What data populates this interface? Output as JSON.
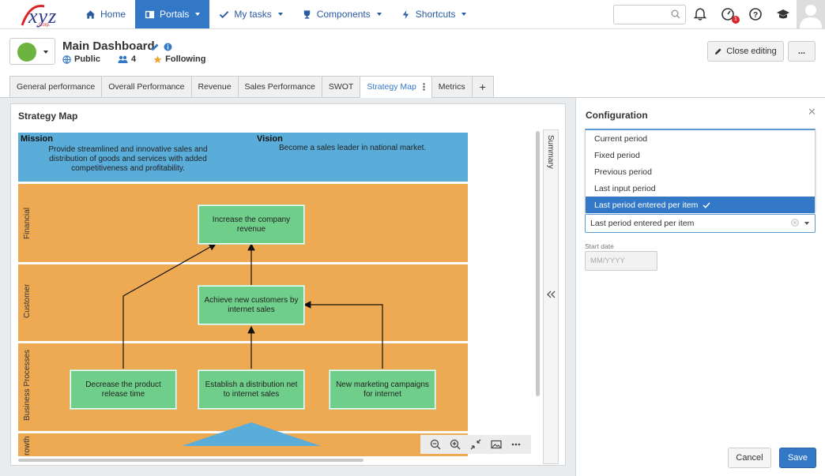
{
  "brand": {
    "logo_text": "xyz",
    "logo_sub": "Corp."
  },
  "nav": {
    "items": [
      {
        "label": "Home",
        "icon": "home-icon"
      },
      {
        "label": "Portals",
        "icon": "portals-icon"
      },
      {
        "label": "My tasks",
        "icon": "check-icon"
      },
      {
        "label": "Components",
        "icon": "trophy-icon"
      },
      {
        "label": "Shortcuts",
        "icon": "bolt-icon"
      }
    ],
    "search_placeholder": "",
    "notification_badge": "1"
  },
  "dashboard": {
    "title": "Main Dashboard",
    "visibility": "Public",
    "members": "4",
    "following": "Following",
    "close_editing": "Close editing",
    "more": "..."
  },
  "tabs": [
    {
      "label": "General performance"
    },
    {
      "label": "Overall Performance"
    },
    {
      "label": "Revenue"
    },
    {
      "label": "Sales Performance"
    },
    {
      "label": "SWOT"
    },
    {
      "label": "Strategy Map",
      "active": true
    },
    {
      "label": "Metrics"
    },
    {
      "label": "+"
    }
  ],
  "widget": {
    "title": "Strategy Map",
    "mission_title": "Mission",
    "mission_text": "Provide streamlined and innovative sales and distribution of goods and services with added competitiveness and profitability.",
    "vision_title": "Vision",
    "vision_text": "Become a sales leader in national market.",
    "perspectives": [
      {
        "label": "Financial"
      },
      {
        "label": "Customer"
      },
      {
        "label": "Business Processes"
      },
      {
        "label": "rowth"
      }
    ],
    "objectives": {
      "revenue": "Increase the company revenue",
      "customers": "Achieve new customers by internet sales",
      "release": "Decrease the product release time",
      "distribution": "Establish a distribution net to internet sales",
      "marketing": "New marketing campaigns for internet"
    },
    "summary_label": "Summary",
    "colors": {
      "mission": "#5aacd9",
      "perspective": "#eeaa52",
      "objective": "#6fcf8a"
    }
  },
  "config": {
    "title": "Configuration",
    "options": [
      {
        "label": "Current period"
      },
      {
        "label": "Fixed period"
      },
      {
        "label": "Previous period"
      },
      {
        "label": "Last input period"
      },
      {
        "label": "Last period entered per item",
        "selected": true
      }
    ],
    "selected_value": "Last period entered per item",
    "start_date_label": "Start date",
    "start_date_placeholder": "MM/YYYY",
    "cancel": "Cancel",
    "save": "Save"
  }
}
